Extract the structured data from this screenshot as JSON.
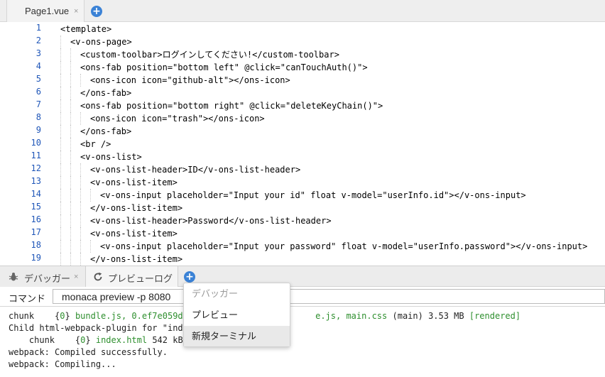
{
  "editor": {
    "tab": {
      "label": "Page1.vue",
      "close": "×"
    },
    "add": "+",
    "line_numbers": [
      "1",
      "2",
      "3",
      "4",
      "5",
      "6",
      "7",
      "8",
      "9",
      "10",
      "11",
      "12",
      "13",
      "14",
      "15",
      "16",
      "17",
      "18",
      "19"
    ],
    "lines": [
      "<template>",
      "<v-ons-page>",
      "<custom-toolbar>ログインしてください!</custom-toolbar>",
      "<ons-fab position=\"bottom left\" @click=\"canTouchAuth()\">",
      "<ons-icon icon=\"github-alt\"></ons-icon>",
      "</ons-fab>",
      "<ons-fab position=\"bottom right\" @click=\"deleteKeyChain()\">",
      "<ons-icon icon=\"trash\"></ons-icon>",
      "</ons-fab>",
      "<br />",
      "<v-ons-list>",
      "<v-ons-list-header>ID</v-ons-list-header>",
      "<v-ons-list-item>",
      "<v-ons-input placeholder=\"Input your id\" float v-model=\"userInfo.id\"></v-ons-input>",
      "</v-ons-list-item>",
      "<v-ons-list-header>Password</v-ons-list-header>",
      "<v-ons-list-item>",
      "<v-ons-input placeholder=\"Input your password\" float v-model=\"userInfo.password\"></v-ons-input>",
      "</v-ons-list-item>"
    ]
  },
  "panel": {
    "tabs": [
      {
        "label": "デバッガー",
        "icon": "bug-icon",
        "close": "×"
      },
      {
        "label": "プレビューログ",
        "icon": "refresh-icon"
      }
    ],
    "add": "+",
    "command_label": "コマンド",
    "command_value": "monaca preview -p 8080",
    "terminal": {
      "l1_a": "chunk    {",
      "l1_b": "0",
      "l1_c": "} ",
      "l1_d": "bundle.js, 0.ef7e059da2",
      "l1_e": "e.js, main.css",
      "l1_f": " (main) 3.53 MB ",
      "l1_g": "[rendered]",
      "l2": "Child html-webpack-plugin for \"index",
      "l3_a": "    chunk    {",
      "l3_b": "0",
      "l3_c": "} ",
      "l3_d": "index.html",
      "l3_e": " 542 kB",
      "l4": "webpack: Compiled successfully.",
      "l5": "webpack: Compiling..."
    }
  },
  "menu": {
    "items": [
      {
        "label": "デバッガー",
        "enabled": false
      },
      {
        "label": "プレビュー",
        "enabled": true
      },
      {
        "label": "新規ターミナル",
        "enabled": true
      }
    ]
  },
  "colors": {
    "accent": "#3b82d6",
    "line_number": "#1f56b8",
    "terminal_green": "#2e8f2e"
  }
}
